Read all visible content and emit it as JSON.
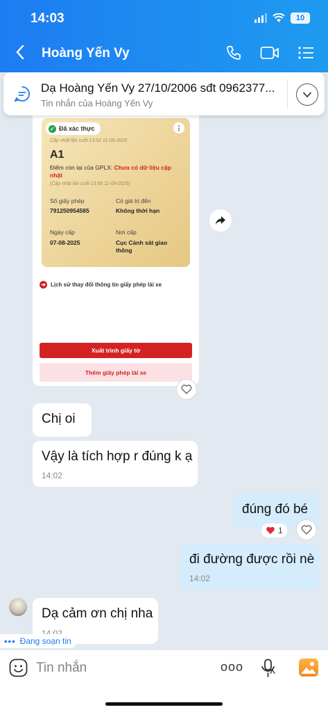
{
  "status_bar": {
    "time": "14:03",
    "battery": "10"
  },
  "header": {
    "title": "Hoàng Yến Vy"
  },
  "pinned": {
    "title": "Dạ Hoàng Yến Vy 27/10/2006 sđt 0962377...",
    "subtitle": "Tin nhắn của Hoàng Yến Vy"
  },
  "license_card": {
    "verified": "Đã xác thực",
    "updated": "Cập nhật lần cuối 13:52 11-09-2025",
    "class": "A1",
    "points_label": "Điểm còn lại của GPLX:",
    "points_value": "Chưa có dữ liệu cập nhật",
    "points_updated": "(Cập nhật lần cuối 13:56 11-09-2025)",
    "number_label": "Số giấy phép",
    "number_value": "791250954585",
    "validity_label": "Có giá trị đến",
    "validity_value": "Không thời hạn",
    "issue_date_label": "Ngày cấp",
    "issue_date_value": "07-08-2025",
    "issuer_label": "Nơi cấp",
    "issuer_value": "Cục Cảnh sát giao thông",
    "history": "Lịch sử thay đổi thông tin giấy phép lái xe",
    "present_button": "Xuất trình giấy tờ",
    "add_button": "Thêm giấy phép lái xe"
  },
  "messages": [
    {
      "text": "Chị oi"
    },
    {
      "text": "Vậy là tích hợp r đúng k ạ",
      "time": "14:02"
    },
    {
      "text": "đúng đó bé",
      "reaction_count": "1"
    },
    {
      "text": "đi đường được rồi nè",
      "time": "14:02"
    },
    {
      "text": "Dạ cảm ơn chị nha",
      "time": "14:02"
    }
  ],
  "typing": "Đang soạn tin",
  "composer": {
    "placeholder": "Tin nhắn",
    "more": "ooo"
  }
}
